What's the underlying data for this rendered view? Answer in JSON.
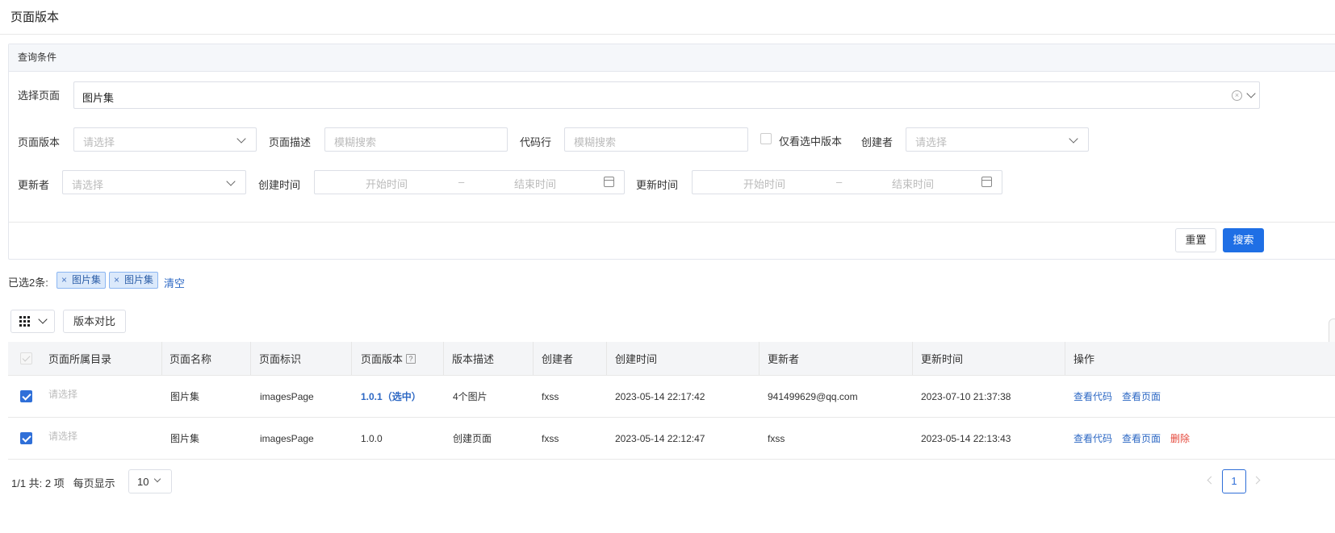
{
  "page": {
    "title": "页面版本"
  },
  "query": {
    "header": "查询条件",
    "page_select": {
      "label": "选择页面",
      "value": "图片集"
    },
    "version": {
      "label": "页面版本",
      "placeholder": "请选择"
    },
    "desc": {
      "label": "页面描述",
      "placeholder": "模糊搜索"
    },
    "code": {
      "label": "代码行",
      "placeholder": "模糊搜索"
    },
    "only_selected": {
      "label": "仅看选中版本",
      "checked": false
    },
    "creator": {
      "label": "创建者",
      "placeholder": "请选择"
    },
    "updater": {
      "label": "更新者",
      "placeholder": "请选择"
    },
    "created_time": {
      "label": "创建时间",
      "start": "开始时间",
      "sep": "–",
      "end": "结束时间"
    },
    "updated_time": {
      "label": "更新时间",
      "start": "开始时间",
      "sep": "–",
      "end": "结束时间"
    },
    "reset_label": "重置",
    "search_label": "搜索"
  },
  "selection": {
    "label": "已选2条:",
    "tags": [
      {
        "x": "×",
        "text": "图片集"
      },
      {
        "x": "×",
        "text": "图片集"
      }
    ],
    "clear_label": "清空"
  },
  "toolbar": {
    "compare_label": "版本对比"
  },
  "table": {
    "headers": [
      "页面所属目录",
      "页面名称",
      "页面标识",
      "页面版本",
      "版本描述",
      "创建者",
      "创建时间",
      "更新者",
      "更新时间",
      "操作"
    ],
    "help_glyph": "?",
    "rows": [
      {
        "checked": true,
        "dir": "请选择",
        "name": "图片集",
        "key": "imagesPage",
        "version": "1.0.1（选中）",
        "desc": "4个图片",
        "creator": "fxss",
        "created": "2023-05-14 22:17:42",
        "updater": "941499629@qq.com",
        "updated": "2023-07-10 21:37:38",
        "ops": [
          "查看代码",
          "查看页面"
        ]
      },
      {
        "checked": true,
        "dir": "请选择",
        "name": "图片集",
        "key": "imagesPage",
        "version": "1.0.0",
        "desc": "创建页面",
        "creator": "fxss",
        "created": "2023-05-14 22:12:47",
        "updater": "fxss",
        "updated": "2023-05-14 22:13:43",
        "ops": [
          "查看代码",
          "查看页面",
          "删除"
        ]
      }
    ]
  },
  "pagination": {
    "info": "1/1 共: 2 项",
    "page_size_label": "每页显示",
    "page_size": "10",
    "current": "1"
  },
  "colors": {
    "primary": "#1f6fe5",
    "link": "#2d68c4",
    "danger": "#e5483b"
  }
}
